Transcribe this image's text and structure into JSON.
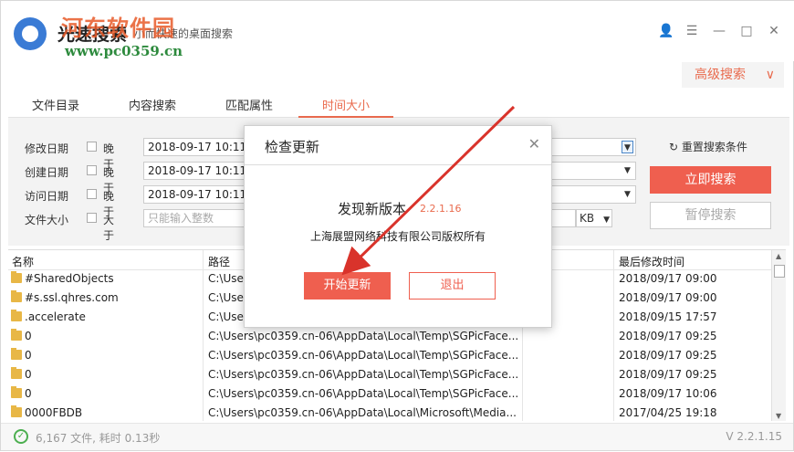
{
  "titlebar": {
    "app_name": "光速搜索",
    "subtitle": "小而快速的桌面搜索",
    "watermark_text": "河东软件园",
    "watermark_url": "www.pc0359.cn",
    "icons": [
      "user-icon",
      "menu-icon",
      "minimize-icon",
      "maximize-icon",
      "close-icon"
    ],
    "user_glyph": "👤",
    "menu_glyph": "☰",
    "minimize_glyph": "—",
    "maximize_glyph": "□",
    "close_glyph": "✕"
  },
  "advanced": {
    "label": "高级搜索",
    "chevron": "∨"
  },
  "tabs": [
    {
      "label": "文件目录"
    },
    {
      "label": "内容搜索"
    },
    {
      "label": "匹配属性"
    },
    {
      "label": "时间大小",
      "active": true
    }
  ],
  "filters": {
    "modified": {
      "label": "修改日期",
      "check_label": "晚于",
      "value": "2018-09-17 10:11"
    },
    "created": {
      "label": "创建日期",
      "check_label": "晚于",
      "value": "2018-09-17 10:11"
    },
    "accessed": {
      "label": "访问日期",
      "check_label": "晚于",
      "value": "2018-09-17 10:11"
    },
    "size": {
      "label": "文件大小",
      "check_label": "大于",
      "placeholder": "只能输入整数",
      "unit": "KB"
    },
    "dropdown_glyph": "▼"
  },
  "actions": {
    "reset_label": "重置搜索条件",
    "reset_glyph": "↻",
    "search_label": "立即搜索",
    "pause_label": "暂停搜索"
  },
  "table": {
    "columns": [
      "名称",
      "路径",
      "最后修改时间"
    ],
    "rows": [
      {
        "name": "#SharedObjects",
        "path": "C:\\Users",
        "time": "2018/09/17 09:00"
      },
      {
        "name": "#s.ssl.qhres.com",
        "path": "C:\\Users",
        "time": "2018/09/17 09:00"
      },
      {
        "name": ".accelerate",
        "path": "C:\\Users",
        "time": "2018/09/15 17:57"
      },
      {
        "name": "0",
        "path": "C:\\Users\\pc0359.cn-06\\AppData\\Local\\Temp\\SGPicFace...",
        "time": "2018/09/17 09:25"
      },
      {
        "name": "0",
        "path": "C:\\Users\\pc0359.cn-06\\AppData\\Local\\Temp\\SGPicFace...",
        "time": "2018/09/17 09:25"
      },
      {
        "name": "0",
        "path": "C:\\Users\\pc0359.cn-06\\AppData\\Local\\Temp\\SGPicFace...",
        "time": "2018/09/17 09:25"
      },
      {
        "name": "0",
        "path": "C:\\Users\\pc0359.cn-06\\AppData\\Local\\Temp\\SGPicFace...",
        "time": "2018/09/17 10:06"
      },
      {
        "name": "0000FBDB",
        "path": "C:\\Users\\pc0359.cn-06\\AppData\\Local\\Microsoft\\Media...",
        "time": "2017/04/25 19:18"
      }
    ]
  },
  "status": {
    "summary": "6,167 文件, 耗时 0.13秒",
    "version": "V 2.2.1.15",
    "ok_glyph": "✓"
  },
  "dialog": {
    "title": "检查更新",
    "close_glyph": "✕",
    "found_label": "发现新版本",
    "new_version": "2.2.1.16",
    "copyright": "上海展盟网络科技有限公司版权所有",
    "update_label": "开始更新",
    "exit_label": "退出"
  },
  "colors": {
    "accent": "#ef5f4f",
    "tab_active": "#e96b4e",
    "annotation_arrow": "#d9332b"
  }
}
